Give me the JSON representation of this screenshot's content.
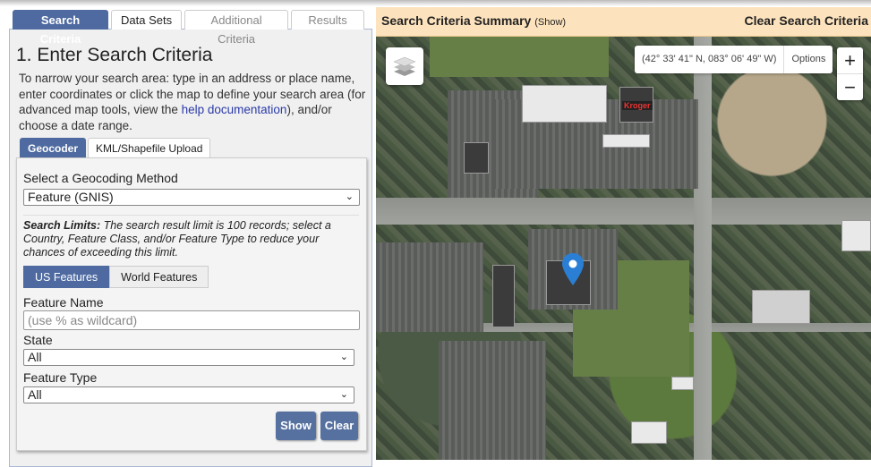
{
  "tabs": {
    "search_criteria": "Search Criteria",
    "data_sets": "Data Sets",
    "additional_criteria": "Additional Criteria",
    "results": "Results"
  },
  "panel": {
    "title": "1. Enter Search Criteria",
    "intro_before": "To narrow your search area: type in an address or place name, enter coordinates or click the map to define your search area (for advanced map tools, view the ",
    "intro_link": "help documentation",
    "intro_after": "), and/or choose a date range."
  },
  "subtabs": {
    "geocoder": "Geocoder",
    "kml": "KML/Shapefile Upload"
  },
  "geocoder": {
    "method_label": "Select a Geocoding Method",
    "method_value": "Feature (GNIS)",
    "limits_bold": "Search Limits:",
    "limits_text": " The search result limit is 100 records; select a Country, Feature Class, and/or Feature Type to reduce your chances of exceeding this limit.",
    "us_features": "US Features",
    "world_features": "World Features",
    "feature_name_label": "Feature Name",
    "feature_name_placeholder": "(use % as wildcard)",
    "feature_name_value": "",
    "state_label": "State",
    "state_value": "All",
    "type_label": "Feature Type",
    "type_value": "All",
    "show": "Show",
    "clear": "Clear"
  },
  "summary": {
    "title": "Search Criteria Summary",
    "show": "(Show)",
    "clear": "Clear Search Criteria"
  },
  "map": {
    "coords": "(42° 33' 41\" N, 083° 06' 49\" W)",
    "options": "Options",
    "zoom_in": "+",
    "zoom_out": "−",
    "store_label": "Kroger",
    "marker_color": "#2a7fd4"
  }
}
